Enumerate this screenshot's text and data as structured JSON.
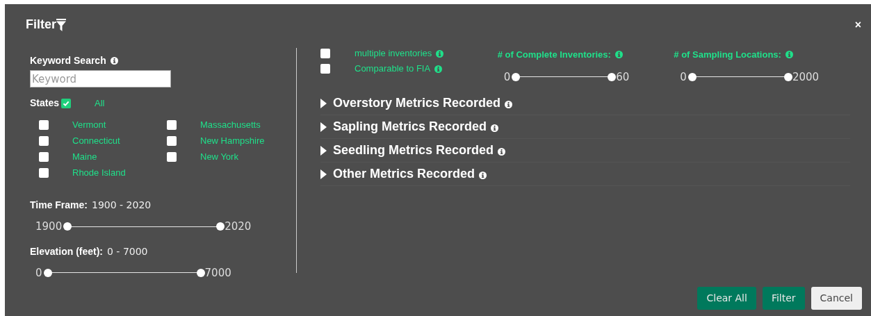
{
  "dialog": {
    "title": "Filter",
    "close": "×"
  },
  "keyword_search": {
    "label": "Keyword Search",
    "placeholder": "Keyword"
  },
  "states": {
    "label": "States",
    "all_checked": true,
    "all_label": "All",
    "items": [
      {
        "label": "Vermont",
        "checked": false
      },
      {
        "label": "Connecticut",
        "checked": false
      },
      {
        "label": "Maine",
        "checked": false
      },
      {
        "label": "Rhode Island",
        "checked": false
      },
      {
        "label": "Massachusetts",
        "checked": false
      },
      {
        "label": "New Hampshire",
        "checked": false
      },
      {
        "label": "New York",
        "checked": false
      }
    ]
  },
  "ranges": [
    {
      "label": "Time Frame:",
      "value": "1900 - 2020",
      "min": "1900",
      "max": "2020",
      "level": 1
    },
    {
      "label": "Elevation (feet):",
      "value": "0 - 7000",
      "min": "0",
      "max": "7000",
      "level": 1
    }
  ],
  "options": [
    {
      "label": "multiple inventories",
      "checked": false
    },
    {
      "label": "Comparable to FIA",
      "checked": false
    }
  ],
  "count_filters": [
    {
      "label": "# of Complete Inventories:",
      "min": "0",
      "max": "60",
      "level": 1
    },
    {
      "label": "# of Sampling Locations:",
      "min": "0",
      "max": "2000",
      "level": 1
    }
  ],
  "sections": [
    {
      "label": "Overstory Metrics Recorded",
      "expanded": false
    },
    {
      "label": "Sapling Metrics Recorded",
      "expanded": false
    },
    {
      "label": "Seedling Metrics Recorded",
      "expanded": false
    },
    {
      "label": "Other Metrics Recorded",
      "expanded": false
    }
  ],
  "buttons": [
    {
      "label": "Clear All",
      "kind": "primary"
    },
    {
      "label": "Filter",
      "kind": "primary"
    },
    {
      "label": "Cancel",
      "kind": "secondary"
    }
  ]
}
